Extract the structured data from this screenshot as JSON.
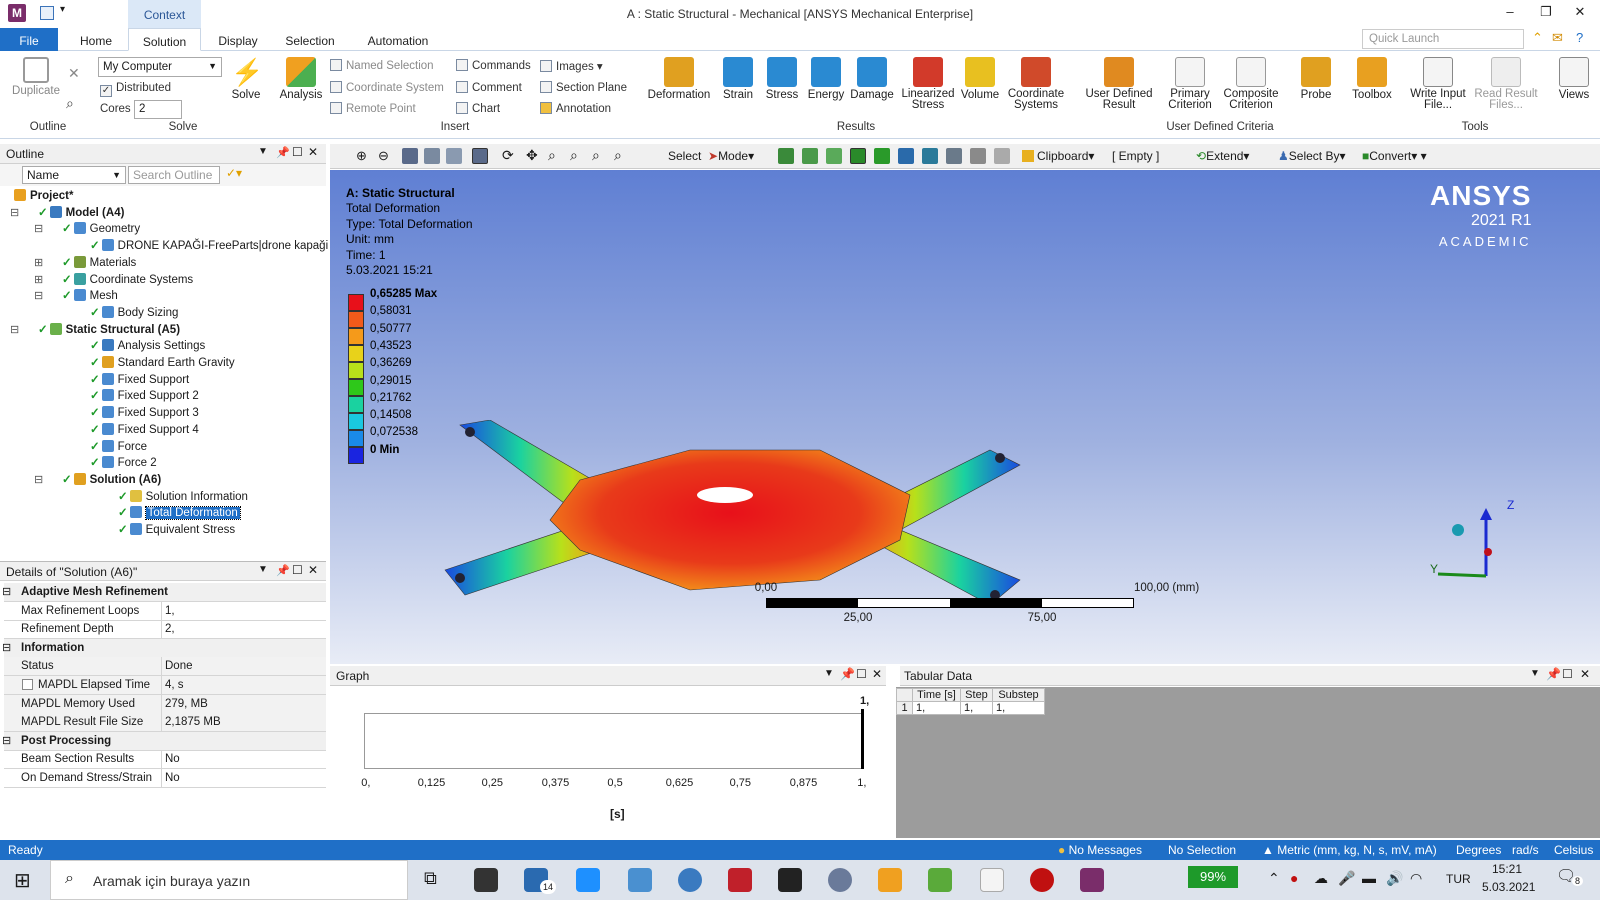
{
  "app": {
    "title": "A : Static Structural - Mechanical [ANSYS Mechanical Enterprise]",
    "context_tab": "Context",
    "quick_launch_placeholder": "Quick Launch"
  },
  "tabs": [
    "File",
    "Home",
    "Solution",
    "Display",
    "Selection",
    "Automation"
  ],
  "ribbon": {
    "outline_group": {
      "duplicate": "Duplicate",
      "label": "Outline"
    },
    "solve_group": {
      "computer": "My Computer",
      "distributed": "Distributed",
      "cores_label": "Cores",
      "cores_value": "2",
      "solve": "Solve",
      "label": "Solve"
    },
    "insert_group": {
      "analysis": "Analysis",
      "named_selection": "Named Selection",
      "coordinate_system": "Coordinate System",
      "remote_point": "Remote Point",
      "commands": "Commands",
      "comment": "Comment",
      "chart": "Chart",
      "images": "Images",
      "section_plane": "Section Plane",
      "annotation": "Annotation",
      "label": "Insert"
    },
    "results_group": {
      "items": [
        "Deformation",
        "Strain",
        "Stress",
        "Energy",
        "Damage",
        "Linearized Stress",
        "Volume",
        "Coordinate Systems"
      ],
      "label": "Results"
    },
    "user_group": {
      "user_defined_result": "User Defined Result",
      "primary_criterion": "Primary Criterion",
      "composite_criterion": "Composite Criterion",
      "label": "User Defined Criteria"
    },
    "tools_group": {
      "probe": "Probe",
      "toolbox": "Toolbox",
      "write_input": "Write Input File...",
      "read_result": "Read Result Files...",
      "label": "Tools"
    },
    "views": "Views"
  },
  "outline": {
    "title": "Outline",
    "filter_label": "Name",
    "search_placeholder": "Search Outline",
    "nodes": [
      {
        "text": "Project*",
        "bold": true
      },
      {
        "text": "Model (A4)",
        "bold": true
      },
      {
        "text": "Geometry"
      },
      {
        "text": "DRONE KAPAĞI-FreeParts|drone kapaği"
      },
      {
        "text": "Materials"
      },
      {
        "text": "Coordinate Systems"
      },
      {
        "text": "Mesh"
      },
      {
        "text": "Body Sizing"
      },
      {
        "text": "Static Structural (A5)",
        "bold": true
      },
      {
        "text": "Analysis Settings"
      },
      {
        "text": "Standard Earth Gravity"
      },
      {
        "text": "Fixed Support"
      },
      {
        "text": "Fixed Support 2"
      },
      {
        "text": "Fixed Support 3"
      },
      {
        "text": "Fixed Support 4"
      },
      {
        "text": "Force"
      },
      {
        "text": "Force 2"
      },
      {
        "text": "Solution (A6)",
        "bold": true
      },
      {
        "text": "Solution Information"
      },
      {
        "text": "Total Deformation",
        "selected": true
      },
      {
        "text": "Equivalent Stress"
      }
    ]
  },
  "details": {
    "title": "Details of \"Solution (A6)\"",
    "rows": [
      {
        "section": "Adaptive Mesh Refinement"
      },
      {
        "k": "Max Refinement Loops",
        "v": "1,"
      },
      {
        "k": "Refinement Depth",
        "v": "2,"
      },
      {
        "section": "Information"
      },
      {
        "k": "Status",
        "v": "Done"
      },
      {
        "k": "MAPDL Elapsed Time",
        "v": "4, s"
      },
      {
        "k": "MAPDL Memory Used",
        "v": "279, MB"
      },
      {
        "k": "MAPDL Result File Size",
        "v": "2,1875 MB"
      },
      {
        "section": "Post Processing"
      },
      {
        "k": "Beam Section Results",
        "v": "No"
      },
      {
        "k": "On Demand Stress/Strain",
        "v": "No"
      }
    ]
  },
  "graphics_toolbar": {
    "select": "Select",
    "mode": "Mode",
    "clipboard": "Clipboard",
    "empty": "[ Empty ]",
    "extend": "Extend",
    "select_by": "Select By",
    "convert": "Convert"
  },
  "viewport": {
    "lines": [
      "A: Static Structural",
      "Total Deformation",
      "Type: Total Deformation",
      "Unit: mm",
      "Time: 1",
      "5.03.2021 15:21"
    ],
    "legend": [
      "0,65285 Max",
      "0,58031",
      "0,50777",
      "0,43523",
      "0,36269",
      "0,29015",
      "0,21762",
      "0,14508",
      "0,072538",
      "0 Min"
    ],
    "legend_colors": [
      "#e8101a",
      "#f25a1a",
      "#f59a1a",
      "#e8d21a",
      "#b8e01a",
      "#2ec81a",
      "#1ad2a0",
      "#1ac8e0",
      "#1a8ae8",
      "#1a24e0"
    ],
    "logo": "ANSYS",
    "version": "2021 R1",
    "edition": "ACADEMIC",
    "scale_labels": [
      "0,00",
      "100,00 (mm)",
      "25,00",
      "75,00"
    ],
    "triad": [
      "Z",
      "Y"
    ]
  },
  "graph": {
    "title": "Graph",
    "x_ticks": [
      "0,",
      "0,125",
      "0,25",
      "0,375",
      "0,5",
      "0,625",
      "0,75",
      "0,875",
      "1,"
    ],
    "top_label": "1,",
    "xlabel": "[s]"
  },
  "tabular": {
    "title": "Tabular Data",
    "headers": [
      "Time [s]",
      "Step",
      "Substep"
    ],
    "row": [
      "1",
      "1,",
      "1,",
      "1,"
    ]
  },
  "status": {
    "ready": "Ready",
    "messages": "No Messages",
    "selection": "No Selection",
    "units": "Metric (mm, kg, N, s, mV, mA)",
    "degrees": "Degrees",
    "rads": "rad/s",
    "temp": "Celsius"
  },
  "taskbar": {
    "search": "Aramak için buraya yazın",
    "battery": "99%",
    "lang": "TUR",
    "time": "15:21",
    "date": "5.03.2021",
    "mail_badge": "14",
    "notif": "8"
  }
}
